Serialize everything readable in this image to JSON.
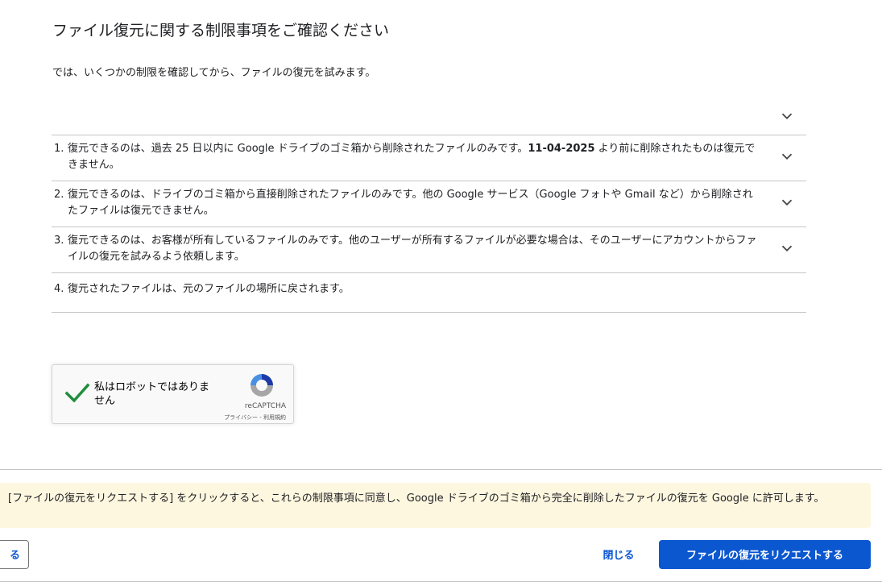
{
  "dialog": {
    "title": "ファイル復元に関する制限事項をご確認ください",
    "intro": "では、いくつかの制限を確認してから、ファイルの復元を試みます。"
  },
  "limits": [
    {
      "num": "1.",
      "text_before": "復元できるのは、過去 25 日以内に Google ドライブのゴミ箱から削除されたファイルのみです。",
      "date": "11-04-2025",
      "text_after": " より前に削除されたものは復元できません。"
    },
    {
      "num": "2.",
      "text": "復元できるのは、ドライブのゴミ箱から直接削除されたファイルのみです。他の Google サービス（Google フォトや Gmail など）から削除されたファイルは復元できません。"
    },
    {
      "num": "3.",
      "text": "復元できるのは、お客様が所有しているファイルのみです。他のユーザーが所有するファイルが必要な場合は、そのユーザーにアカウントからファイルの復元を試みるよう依頼します。"
    },
    {
      "num": "4.",
      "text": "復元されたファイルは、元のファイルの場所に戻されます。"
    }
  ],
  "captcha": {
    "label": "私はロボットではありません",
    "brand": "reCAPTCHA",
    "terms": "プライバシー - 利用規約",
    "checked": true
  },
  "notice": "[ファイルの復元をリクエストする] をクリックすると、これらの制限事項に同意し、Google ドライブのゴミ箱から完全に削除したファイルの復元を Google に許可します。",
  "buttons": {
    "left_partial": "る",
    "close": "閉じる",
    "request": "ファイルの復元をリクエストする"
  },
  "colors": {
    "primary": "#0b57d0",
    "notice_bg": "#fef7e0",
    "check": "#1e8e3e"
  }
}
